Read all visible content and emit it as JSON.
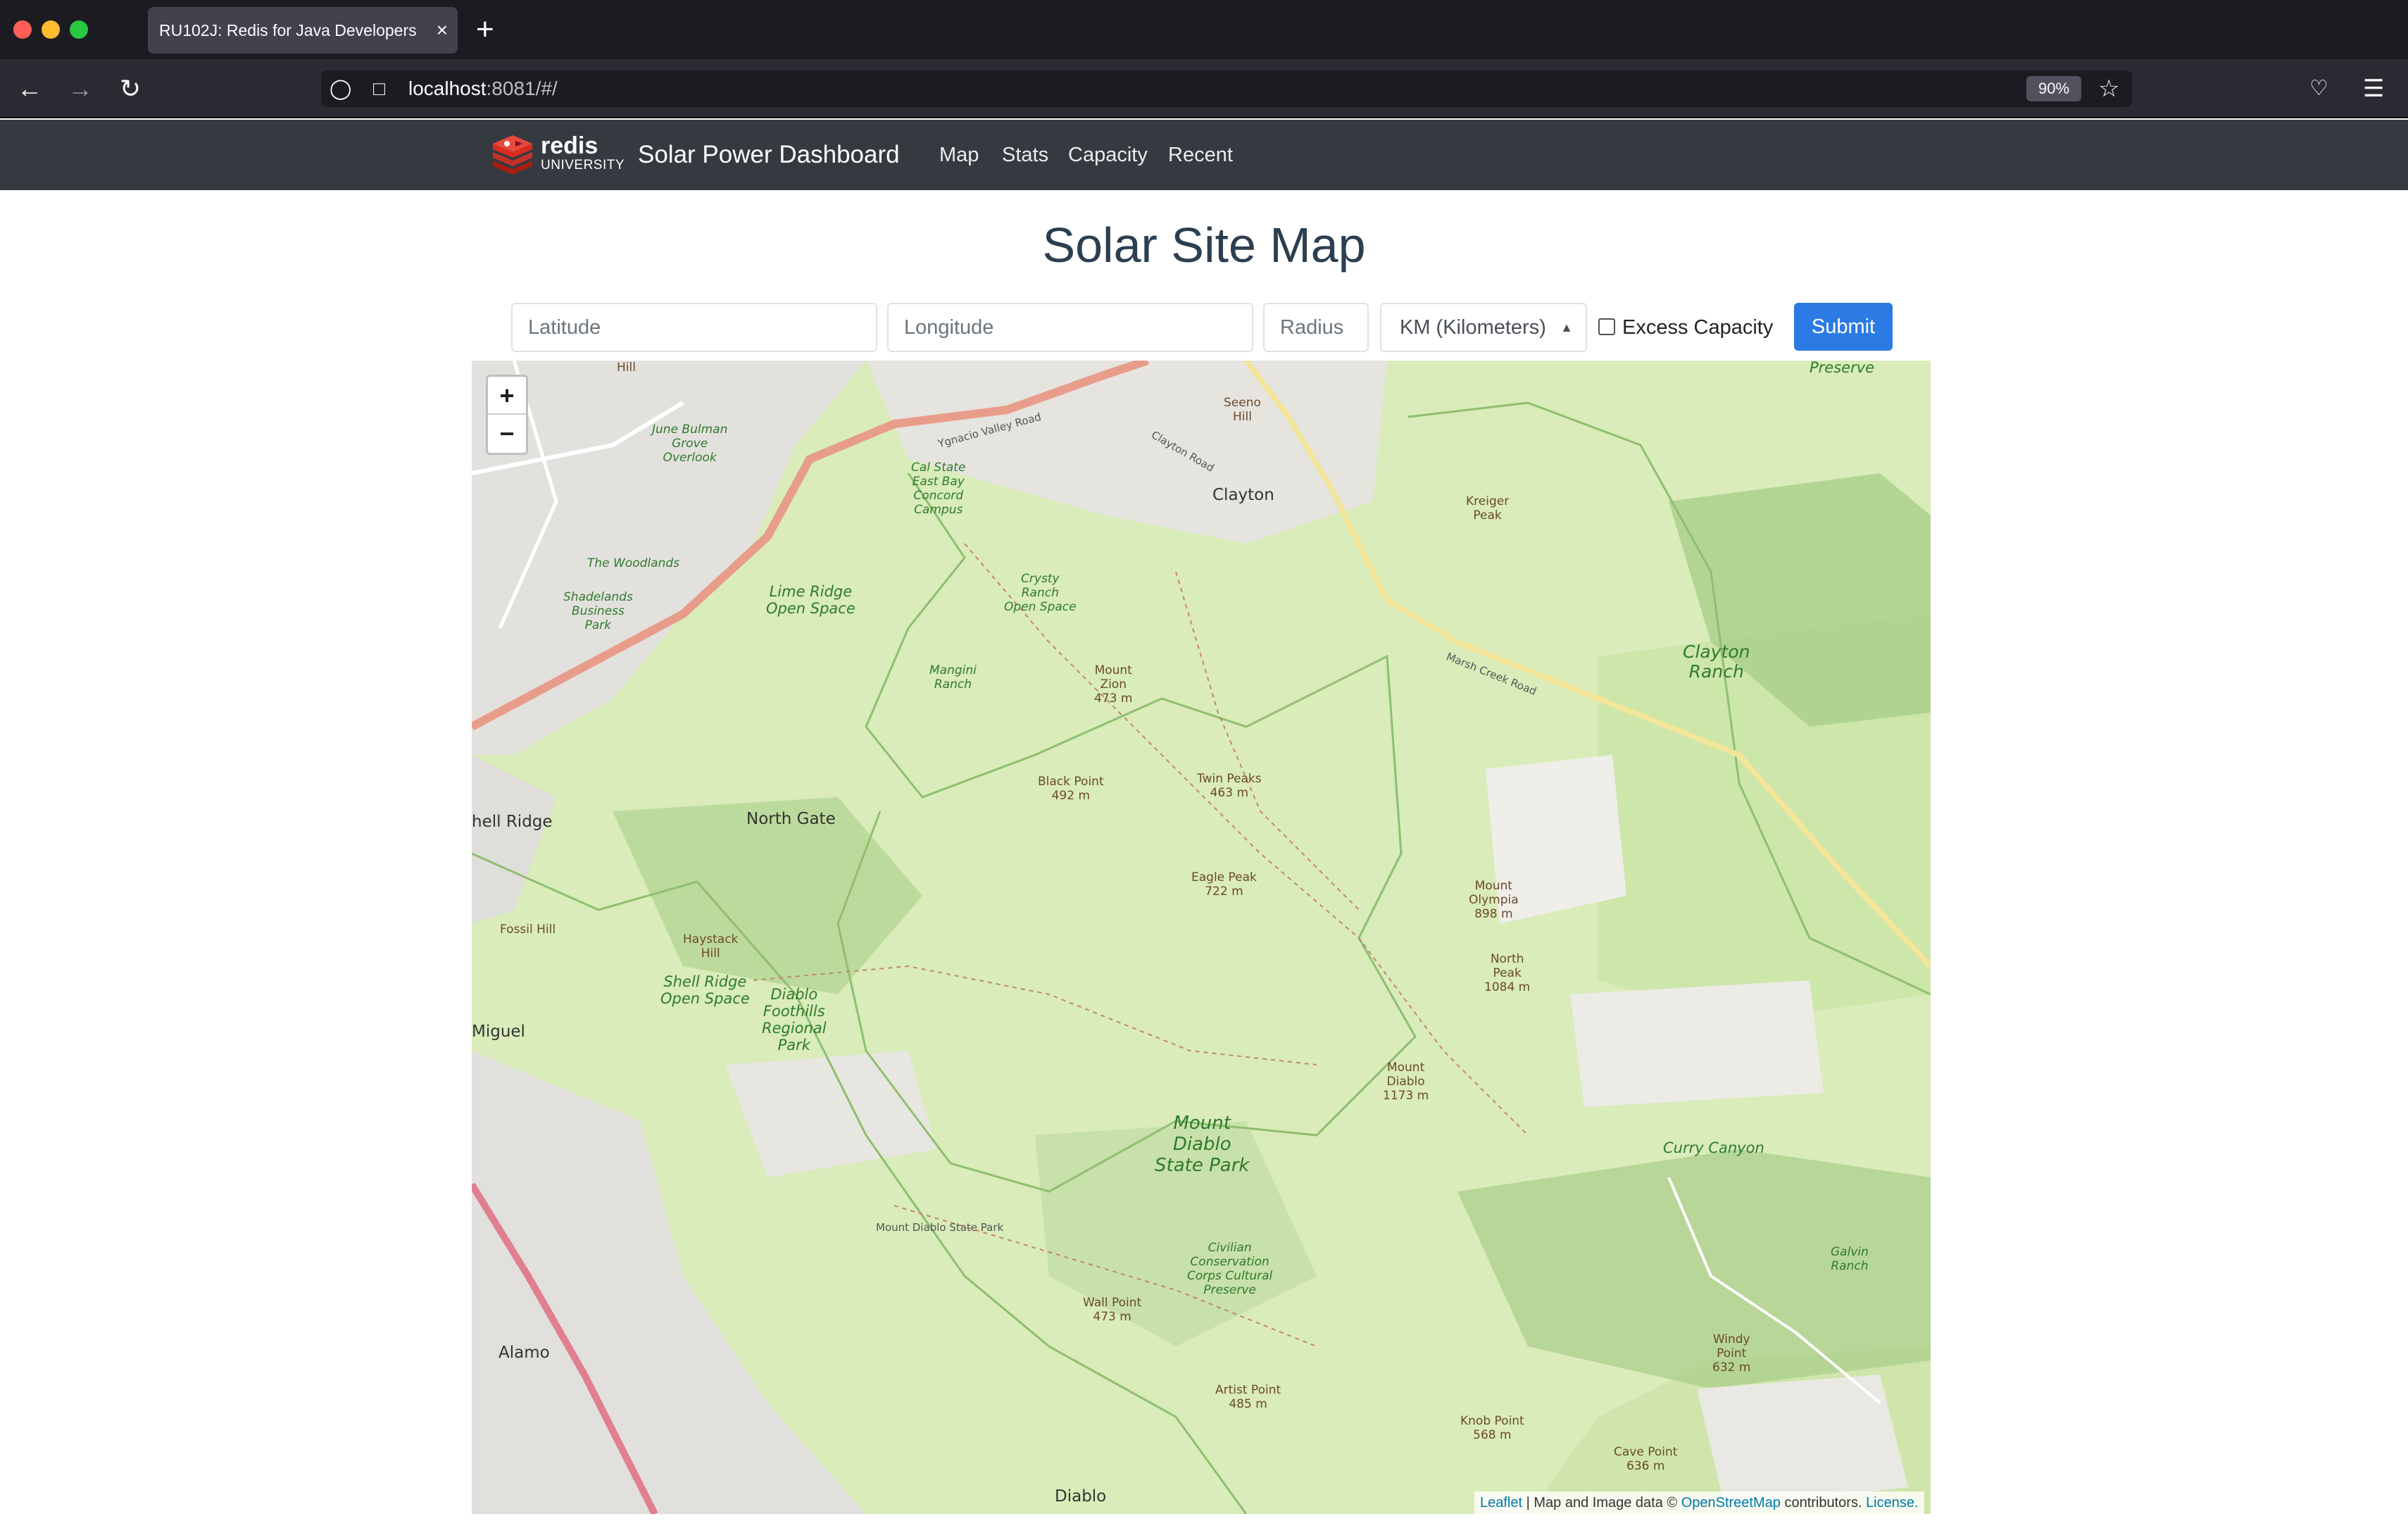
{
  "browser": {
    "tab_title": "RU102J: Redis for Java Developers",
    "tab_close": "×",
    "new_tab": "+",
    "url_host": "localhost",
    "url_rest": ":8081/#/",
    "zoom": "90%",
    "icons": [
      "back-arrow-icon",
      "forward-arrow-icon",
      "reload-icon",
      "shield-icon",
      "page-icon",
      "star-icon",
      "pocket-icon",
      "menu-icon"
    ]
  },
  "app": {
    "logo_text": "redis",
    "logo_sub": "UNIVERSITY",
    "brand": "Solar Power Dashboard",
    "nav": [
      "Map",
      "Stats",
      "Capacity",
      "Recent"
    ]
  },
  "page": {
    "title": "Solar Site Map",
    "form": {
      "latitude_placeholder": "Latitude",
      "longitude_placeholder": "Longitude",
      "radius_placeholder": "Radius",
      "unit_selected": "KM (Kilometers)",
      "excess_label": "Excess Capacity",
      "submit_label": "Submit"
    }
  },
  "map": {
    "zoom_in": "+",
    "zoom_out": "−",
    "attribution": {
      "leaflet": "Leaflet",
      "text": " | Map and Image data © ",
      "osm": "OpenStreetMap",
      "contrib": " contributors. ",
      "license": "License."
    },
    "labels": {
      "preserve": "Preserve",
      "clayton": "Clayton",
      "kreiger": "Kreiger\nPeak",
      "clayton_ranch": "Clayton\nRanch",
      "lime_ridge": "Lime Ridge\nOpen Space",
      "cal_state": "Cal State\nEast Bay\nConcord\nCampus",
      "crysty": "Crysty\nRanch\nOpen Space",
      "june": "June Bulman\nGrove\nOverlook",
      "woodlands": "The Woodlands",
      "shadelands": "Shadelands\nBusiness\nPark",
      "mangini": "Mangini\nRanch",
      "mount_zion": "Mount\nZion\n473 m",
      "black_point": "Black Point\n492 m",
      "twin_peaks": "Twin Peaks\n463 m",
      "eagle_peak": "Eagle Peak\n722 m",
      "mount_olympia": "Mount\nOlympia\n898 m",
      "north_peak": "North\nPeak\n1084 m",
      "mount_diablo": "Mount\nDiablo\n1173 m",
      "shell_ridge": "hell Ridge",
      "north_gate": "North Gate",
      "fossil_hill": "Fossil Hill",
      "haystack": "Haystack\nHill",
      "shell_ridge_os": "Shell Ridge\nOpen Space",
      "diablo_foothills": "Diablo\nFoothills\nRegional\nPark",
      "miguel": "Miguel",
      "mdsp": "Mount\nDiablo\nState Park",
      "mdsp_road": "Mount Diablo State Park",
      "curry": "Curry Canyon",
      "ccc": "Civilian\nConservation\nCorps Cultural\nPreserve",
      "wall_point": "Wall Point\n473 m",
      "artist_point": "Artist Point\n485 m",
      "knob_point": "Knob Point\n568 m",
      "cave_point": "Cave Point\n636 m",
      "windy_point": "Windy\nPoint\n632 m",
      "galvin": "Galvin\nRanch",
      "alamo": "Alamo",
      "diablo": "Diablo",
      "seeno": "Seeno\nHill",
      "hill": "Hill",
      "marsh_creek": "Marsh Creek Road",
      "ygnacio": "Ygnacio Valley Road",
      "clayton_road": "Clayton Road"
    }
  }
}
